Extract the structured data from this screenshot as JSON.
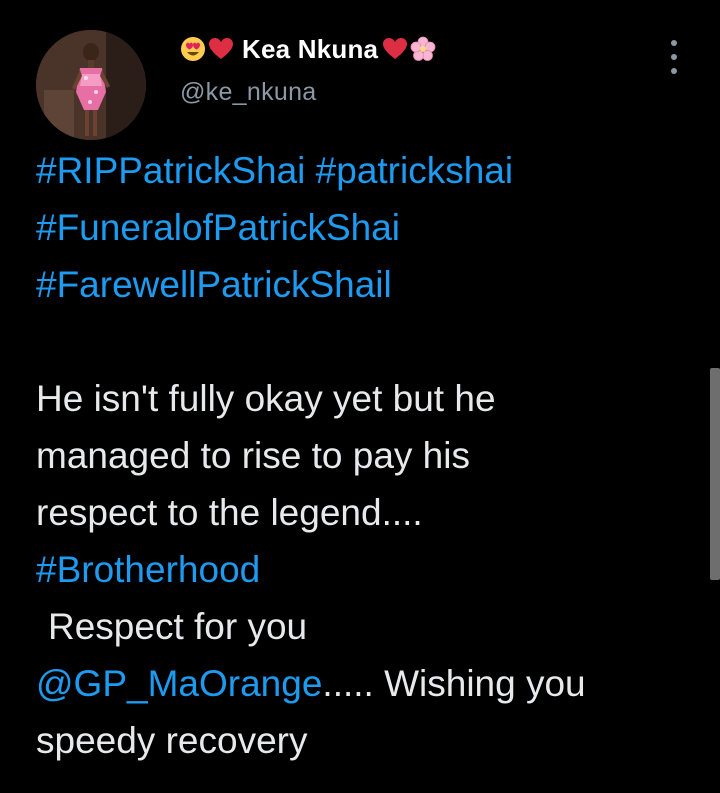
{
  "author": {
    "display_name": "Kea Nkuna",
    "handle": "@ke_nkuna",
    "avatar": "profile-photo-woman-in-pink-dress",
    "name_prefix_icons": [
      "heart-eyes-icon",
      "red-heart-icon"
    ],
    "name_suffix_icons": [
      "red-heart-icon",
      "cherry-blossom-icon"
    ]
  },
  "menu": {
    "icon": "more-vertical-icon"
  },
  "tweet": {
    "hashtags_line1_a": "#RIPPatrickShai",
    "hashtags_line1_b": "#patrickshai",
    "hashtag_line2": "#FuneralofPatrickShai",
    "hashtag_line3": "#FarewellPatrickShail",
    "text_line1": "He isn't fully okay yet but he",
    "text_line2": "managed to rise to pay his",
    "text_line3": "respect to the legend....",
    "hashtag_brotherhood": "#Brotherhood",
    "text_respect": "Respect for you",
    "mention": "@GP_MaOrange",
    "text_after_mention": "..... Wishing you",
    "text_last": "speedy recovery"
  },
  "colors": {
    "background": "#000000",
    "text": "#e7e9ea",
    "link": "#1d9bf0",
    "secondary": "#8b98a5",
    "heart": "#e0245e"
  }
}
